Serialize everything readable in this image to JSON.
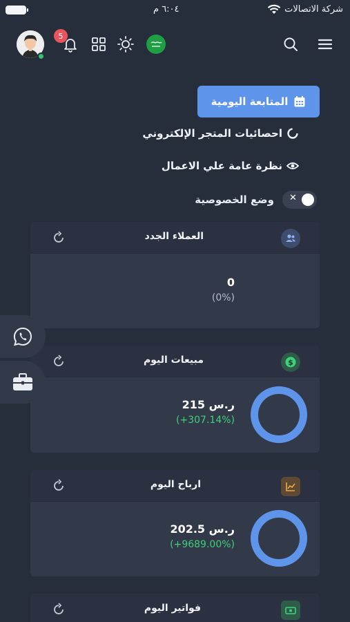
{
  "status_bar": {
    "carrier": "شركة الاتصالات",
    "time": "٦:٠٤ م"
  },
  "header": {
    "notification_count": "5",
    "icons": [
      "avatar",
      "bell-icon",
      "apps-grid-icon",
      "sun-icon",
      "saudi-flag-icon",
      "search-icon",
      "menu-icon"
    ]
  },
  "actions": {
    "daily_followup": "المتابعة اليومية",
    "store_stats": "احصائيات المتجر الإلكتروني",
    "overview": "نظرة عامة علي الاعمال",
    "privacy_mode": "وضع الخصوصية"
  },
  "cards": {
    "new_customers": {
      "title": "العملاء الجدد",
      "value": "0",
      "change": "(0%)"
    },
    "today_sales": {
      "title": "مبيعات اليوم",
      "value": "215 ر.س",
      "change": "(+307.14%)"
    },
    "today_profits": {
      "title": "ارباح اليوم",
      "value": "202.5 ر.س",
      "change": "(+9689.00%)"
    },
    "today_invoices": {
      "title": "فواتير اليوم"
    }
  },
  "colors": {
    "background": "#262d3b",
    "card": "#323948",
    "accent": "#5e95ea",
    "positive": "#3ed17a",
    "badge": "#e8555d"
  }
}
